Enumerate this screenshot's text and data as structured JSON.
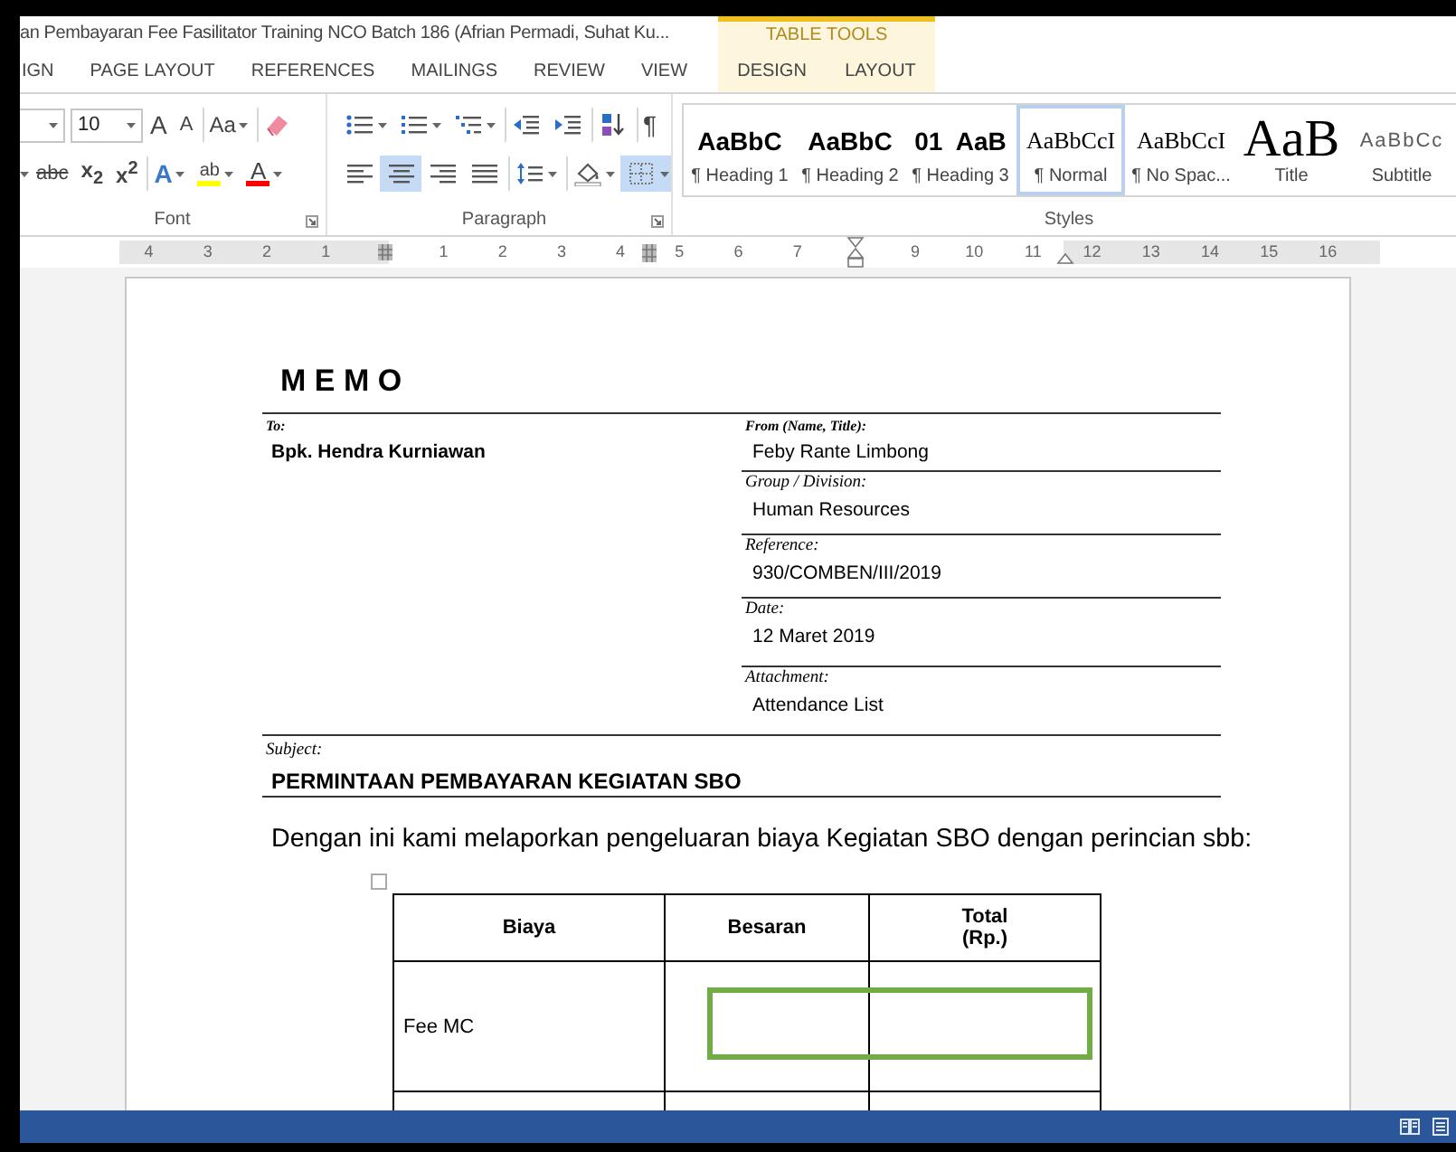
{
  "window": {
    "title": "an Pembayaran Fee Fasilitator Training NCO Batch 186 (Afrian Permadi, Suhat Ku..."
  },
  "tabs": [
    {
      "label": "IGN",
      "selected": false
    },
    {
      "label": "PAGE LAYOUT",
      "selected": false
    },
    {
      "label": "REFERENCES",
      "selected": false
    },
    {
      "label": "MAILINGS",
      "selected": false
    },
    {
      "label": "REVIEW",
      "selected": false
    },
    {
      "label": "VIEW",
      "selected": false
    }
  ],
  "contextual_tab_group": {
    "title": "TABLE TOOLS",
    "tabs": [
      {
        "label": "DESIGN",
        "selected": false
      },
      {
        "label": "LAYOUT",
        "selected": false
      }
    ]
  },
  "font_group": {
    "label": "Font",
    "font_size": "10",
    "row1": [
      {
        "kind": "grow",
        "text": "A",
        "dropdown": false,
        "separator_before": false
      },
      {
        "kind": "shrink",
        "text": "A",
        "dropdown": false,
        "separator_before": false
      },
      {
        "kind": "case",
        "text": "Aa",
        "dropdown": true,
        "separator_before": true
      },
      {
        "kind": "clear",
        "dropdown": false,
        "separator_before": true
      }
    ],
    "row2": [
      {
        "kind": "strike",
        "text": "abc",
        "dropdown": false,
        "separator_before": false
      },
      {
        "kind": "script",
        "text": "x$_{2}$",
        "dropdown": false,
        "separator_before": false
      },
      {
        "kind": "script",
        "text": "x$^{2}$",
        "dropdown": false,
        "separator_before": false
      },
      {
        "kind": "effects",
        "text": "A",
        "color": "#3a78c8",
        "dropdown": true,
        "separator_before": true
      },
      {
        "kind": "highlight",
        "text": "ab",
        "color": "#ffff00",
        "dropdown": true,
        "separator_before": false
      },
      {
        "kind": "font-color",
        "text": "A",
        "color": "#ff0000",
        "dropdown": true,
        "separator_before": false
      }
    ]
  },
  "paragraph_group": {
    "label": "Paragraph",
    "row1": [
      {
        "kind": "bullets",
        "dropdown": true,
        "separator_before": false,
        "selected": false
      },
      {
        "kind": "numbering",
        "dropdown": true,
        "separator_before": false,
        "selected": false
      },
      {
        "kind": "multilevel",
        "dropdown": true,
        "separator_before": false,
        "selected": false
      },
      {
        "kind": "outdent",
        "dropdown": false,
        "separator_before": true,
        "selected": false
      },
      {
        "kind": "indent",
        "dropdown": false,
        "separator_before": false,
        "selected": false
      },
      {
        "kind": "sort",
        "dropdown": false,
        "separator_before": true,
        "selected": false
      },
      {
        "kind": "marks",
        "text": "¶",
        "dropdown": false,
        "separator_before": true,
        "selected": false
      }
    ],
    "row2": [
      {
        "kind": "align-left",
        "dropdown": false,
        "separator_before": false,
        "selected": false
      },
      {
        "kind": "align-center",
        "dropdown": false,
        "separator_before": false,
        "selected": true
      },
      {
        "kind": "align-right",
        "dropdown": false,
        "separator_before": false,
        "selected": false
      },
      {
        "kind": "justify",
        "dropdown": false,
        "separator_before": false,
        "selected": false
      },
      {
        "kind": "line-spacing",
        "dropdown": true,
        "separator_before": true,
        "selected": false
      },
      {
        "kind": "shading",
        "dropdown": true,
        "separator_before": true,
        "selected": false
      },
      {
        "kind": "borders",
        "dropdown": true,
        "separator_before": false,
        "selected": true
      }
    ]
  },
  "styles_group": {
    "label": "Styles",
    "items": [
      {
        "preview": "AaBbC",
        "name": "¶ Heading 1",
        "kind": "heading",
        "selected": false
      },
      {
        "preview": "AaBbC",
        "name": "¶ Heading 2",
        "kind": "heading",
        "selected": false
      },
      {
        "preview": "01  AaB",
        "name": "¶ Heading 3",
        "kind": "heading",
        "selected": false
      },
      {
        "preview": "AaBbCcI",
        "name": "¶ Normal",
        "kind": "normal",
        "selected": true
      },
      {
        "preview": "AaBbCcI",
        "name": "¶ No Spac...",
        "kind": "normal",
        "selected": false
      },
      {
        "preview": "AaB",
        "name": "Title",
        "kind": "title",
        "selected": false
      },
      {
        "preview": "AaBbCc",
        "name": "Subtitle",
        "kind": "subtitle",
        "selected": false
      }
    ]
  },
  "ruler": [
    {
      "kind": "number",
      "text": "4"
    },
    {
      "kind": "number",
      "text": "3"
    },
    {
      "kind": "number",
      "text": "2"
    },
    {
      "kind": "number",
      "text": "1"
    },
    {
      "kind": "margin-marker"
    },
    {
      "kind": "number",
      "text": "1"
    },
    {
      "kind": "number",
      "text": "2"
    },
    {
      "kind": "number",
      "text": "3"
    },
    {
      "kind": "number",
      "text": "4"
    },
    {
      "kind": "column-marker"
    },
    {
      "kind": "number",
      "text": "5"
    },
    {
      "kind": "number",
      "text": "6"
    },
    {
      "kind": "number",
      "text": "7"
    },
    {
      "kind": "indent-marker"
    },
    {
      "kind": "number",
      "text": "9"
    },
    {
      "kind": "number",
      "text": "10"
    },
    {
      "kind": "number",
      "text": "11"
    },
    {
      "kind": "hanging-marker"
    },
    {
      "kind": "number",
      "text": "12"
    },
    {
      "kind": "number",
      "text": "13"
    },
    {
      "kind": "number",
      "text": "14"
    },
    {
      "kind": "number",
      "text": "15"
    },
    {
      "kind": "number",
      "text": "16"
    }
  ],
  "memo": {
    "title": "M E M O",
    "to": {
      "label": "To:",
      "value": "Bpk. Hendra Kurniawan"
    },
    "fields": [
      {
        "label": "From (Name, Title):",
        "value": "Feby Rante Limbong"
      },
      {
        "label": "Group / Division:",
        "value": "Human Resources"
      },
      {
        "label": "Reference:",
        "value": "930/COMBEN/III/2019"
      },
      {
        "label": "Date:",
        "value": "12 Maret 2019"
      },
      {
        "label": "Attachment:",
        "value": "Attendance List"
      }
    ],
    "subject": {
      "label": "Subject:",
      "value": "PERMINTAAN PEMBAYARAN KEGIATAN SBO"
    },
    "body": "Dengan ini kami melaporkan pengeluaran biaya Kegiatan SBO dengan perincian sbb:",
    "table": {
      "columns": [
        "Biaya",
        "Besaran",
        "Total\n(Rp.)"
      ],
      "rows": [
        [
          "Fee MC",
          "",
          ""
        ]
      ]
    }
  }
}
